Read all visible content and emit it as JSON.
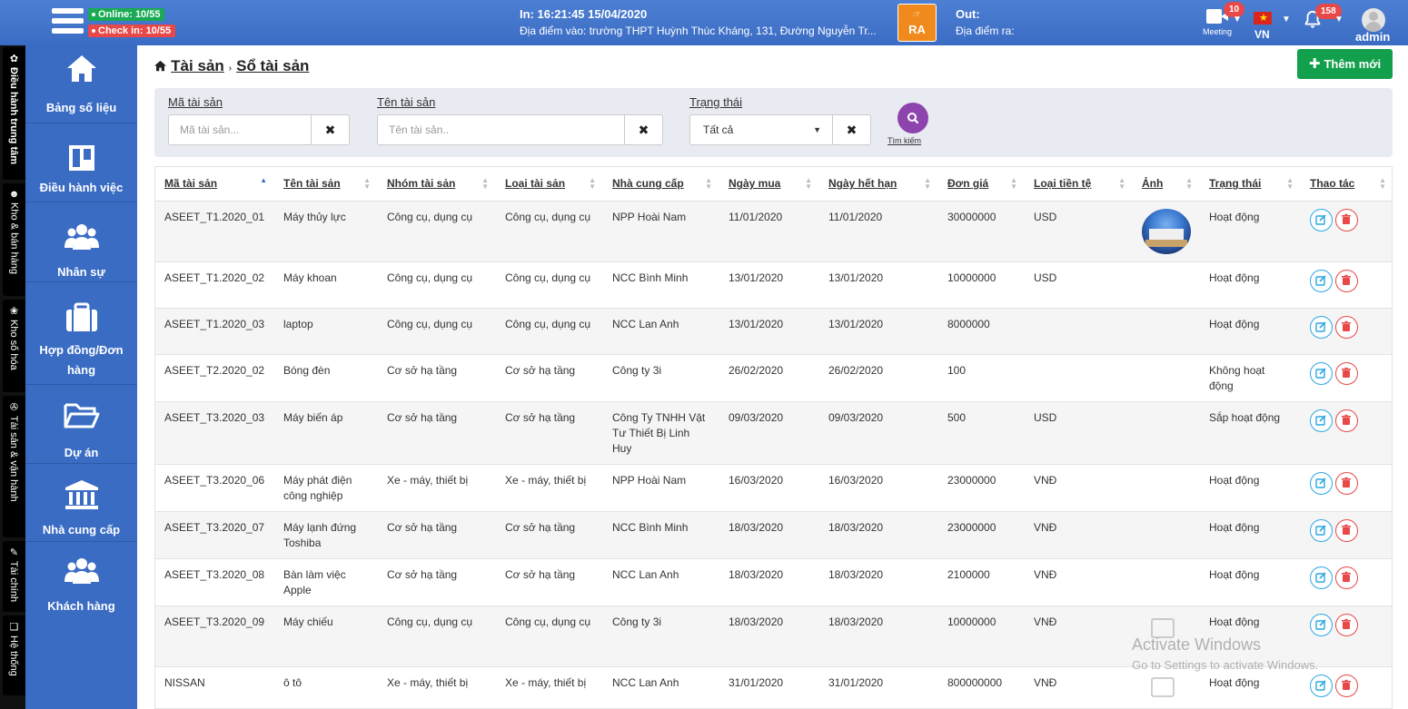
{
  "header": {
    "online": "Online: 10/55",
    "checkin": "Check in: 10/55",
    "in_time": "In: 16:21:45 15/04/2020",
    "in_location": "Địa điểm vào: trường THPT Huỳnh Thúc Kháng, 131, Đường Nguyễn Tr...",
    "logo_top": "RA",
    "logo_text": "RA",
    "out_label": "Out:",
    "out_location": "Địa điểm ra:",
    "meeting_label": "Meeting",
    "meeting_count": "10",
    "lang": "VN",
    "notif_count": "158",
    "user": "admin"
  },
  "vertical_tabs": [
    "✿ Điều hành trung tâm",
    "☻ Kho & bán hàng",
    "❀ Kho số hóa",
    "✇ Tài sản & vận hành",
    "✎ Tài chính",
    "❏ Hệ thống"
  ],
  "sidenav": [
    {
      "label": "Bảng số liệu",
      "icon": "home-icon"
    },
    {
      "label": "Điều hành việc",
      "icon": "board-icon"
    },
    {
      "label": "Nhân sự",
      "icon": "users-icon"
    },
    {
      "label": "Hợp đồng/Đơn hàng",
      "icon": "briefcase-icon"
    },
    {
      "label": "Dự án",
      "icon": "folder-icon"
    },
    {
      "label": "Nhà cung cấp",
      "icon": "bank-icon"
    },
    {
      "label": "Khách hàng",
      "icon": "users-icon"
    }
  ],
  "breadcrumb": {
    "root": "Tài sản",
    "sep": "›",
    "current": "Sổ tài sản"
  },
  "add_button": "Thêm mới",
  "filters": {
    "code_label": "Mã tài sản",
    "code_placeholder": "Mã tài sản...",
    "name_label": "Tên tài sản",
    "name_placeholder": "Tên tài sản..",
    "status_label": "Trạng thái",
    "status_value": "Tất cả",
    "search_label": "Tìm kiếm"
  },
  "table": {
    "columns": [
      "Mã tài sản",
      "Tên tài sản",
      "Nhóm tài sản",
      "Loại tài sản",
      "Nhà cung cấp",
      "Ngày mua",
      "Ngày hết hạn",
      "Đơn giá",
      "Loại tiền tệ",
      "Ảnh",
      "Trạng thái",
      "Thao tác"
    ],
    "rows": [
      {
        "code": "ASEET_T1.2020_01",
        "name": "Máy thủy lực",
        "group": "Công cụ, dụng cụ",
        "type": "Công cụ, dụng cụ",
        "supplier": "NPP Hoài Nam",
        "buy": "11/01/2020",
        "expire": "11/01/2020",
        "price": "30000000",
        "currency": "USD",
        "has_image": true,
        "status": "Hoạt động"
      },
      {
        "code": "ASEET_T1.2020_02",
        "name": "Máy khoan",
        "group": "Công cụ, dụng cụ",
        "type": "Công cụ, dụng cụ",
        "supplier": "NCC Bình Minh",
        "buy": "13/01/2020",
        "expire": "13/01/2020",
        "price": "10000000",
        "currency": "USD",
        "has_image": false,
        "status": "Hoạt động"
      },
      {
        "code": "ASEET_T1.2020_03",
        "name": "laptop",
        "group": "Công cụ, dụng cụ",
        "type": "Công cụ, dụng cụ",
        "supplier": "NCC Lan Anh",
        "buy": "13/01/2020",
        "expire": "13/01/2020",
        "price": "8000000",
        "currency": "",
        "has_image": false,
        "status": "Hoạt động"
      },
      {
        "code": "ASEET_T2.2020_02",
        "name": "Bóng đèn",
        "group": "Cơ sở hạ tầng",
        "type": "Cơ sở hạ tầng",
        "supplier": "Công ty 3i",
        "buy": "26/02/2020",
        "expire": "26/02/2020",
        "price": "100",
        "currency": "",
        "has_image": false,
        "status": "Không hoạt động"
      },
      {
        "code": "ASEET_T3.2020_03",
        "name": "Máy biến áp",
        "group": "Cơ sở hạ tầng",
        "type": "Cơ sở hạ tầng",
        "supplier": "Công Ty TNHH Vật Tư Thiết Bị Linh Huy",
        "buy": "09/03/2020",
        "expire": "09/03/2020",
        "price": "500",
        "currency": "USD",
        "has_image": false,
        "status": "Sắp hoạt động"
      },
      {
        "code": "ASEET_T3.2020_06",
        "name": "Máy phát điện công nghiệp",
        "group": "Xe - máy, thiết bị",
        "type": "Xe - máy, thiết bị",
        "supplier": "NPP Hoài Nam",
        "buy": "16/03/2020",
        "expire": "16/03/2020",
        "price": "23000000",
        "currency": "VNĐ",
        "has_image": false,
        "status": "Hoạt động"
      },
      {
        "code": "ASEET_T3.2020_07",
        "name": "Máy lạnh đứng Toshiba",
        "group": "Cơ sở hạ tầng",
        "type": "Cơ sở hạ tầng",
        "supplier": "NCC Bình Minh",
        "buy": "18/03/2020",
        "expire": "18/03/2020",
        "price": "23000000",
        "currency": "VNĐ",
        "has_image": false,
        "status": "Hoạt động"
      },
      {
        "code": "ASEET_T3.2020_08",
        "name": "Bàn làm việc Apple",
        "group": "Cơ sở hạ tầng",
        "type": "Cơ sở hạ tầng",
        "supplier": "NCC Lan Anh",
        "buy": "18/03/2020",
        "expire": "18/03/2020",
        "price": "2100000",
        "currency": "VNĐ",
        "has_image": false,
        "status": "Hoạt động"
      },
      {
        "code": "ASEET_T3.2020_09",
        "name": "Máy chiếu",
        "group": "Công cụ, dụng cụ",
        "type": "Công cụ, dụng cụ",
        "supplier": "Công ty 3i",
        "buy": "18/03/2020",
        "expire": "18/03/2020",
        "price": "10000000",
        "currency": "VNĐ",
        "has_image": false,
        "status": "Hoạt động"
      },
      {
        "code": "NISSAN",
        "name": "ô tô",
        "group": "Xe - máy, thiết bị",
        "type": "Xe - máy, thiết bị",
        "supplier": "NCC Lan Anh",
        "buy": "31/01/2020",
        "expire": "31/01/2020",
        "price": "800000000",
        "currency": "VNĐ",
        "has_image": false,
        "status": "Hoạt động"
      }
    ]
  },
  "watermark": {
    "title": "Activate Windows",
    "subtitle": "Go to Settings to activate Windows."
  },
  "colors": {
    "topbar": "#3a6cc4",
    "add": "#13a04c",
    "search": "#8e44ad",
    "edit": "#2aa7e2",
    "delete": "#e84848"
  }
}
